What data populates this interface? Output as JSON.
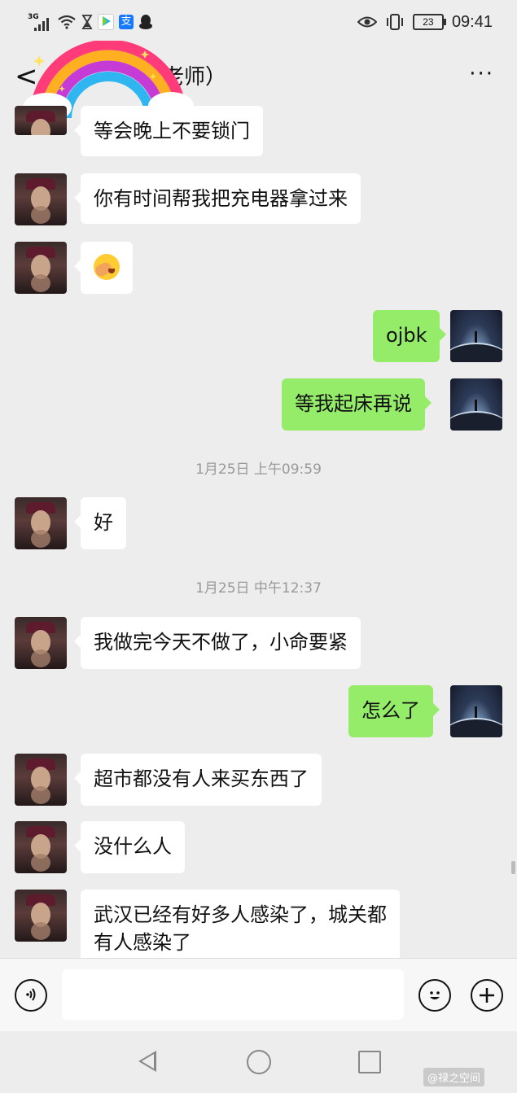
{
  "status_bar": {
    "network": "3G",
    "time": "09:41",
    "battery": "23",
    "app_icons": [
      "hourglass-icon",
      "video-app-icon",
      "alipay-icon",
      "qq-icon"
    ]
  },
  "header": {
    "back_label": "<",
    "title": "老师）",
    "more_label": "···"
  },
  "messages": [
    {
      "side": "in",
      "text": "等会晚上不要锁门"
    },
    {
      "side": "in",
      "text": "你有时间帮我把充电器拿过来"
    },
    {
      "side": "in",
      "text": "",
      "emoji": "facepalm-emoji"
    },
    {
      "side": "out",
      "text": "ojbk"
    },
    {
      "side": "out",
      "text": "等我起床再说"
    },
    {
      "type": "timestamp",
      "text": "1月25日 上午09:59"
    },
    {
      "side": "in",
      "text": "好"
    },
    {
      "type": "timestamp",
      "text": "1月25日 中午12:37"
    },
    {
      "side": "in",
      "text": "我做完今天不做了，小命要紧"
    },
    {
      "side": "out",
      "text": "怎么了"
    },
    {
      "side": "in",
      "text": "超市都没有人来买东西了"
    },
    {
      "side": "in",
      "text": "没什么人"
    },
    {
      "side": "in",
      "text_line1": "武汉已经有好多人感染了，城关都",
      "text_line2": "有人感染了"
    }
  ],
  "input_bar": {
    "value": "",
    "placeholder": ""
  },
  "watermark": "@禄之空间",
  "colors": {
    "background": "#ededed",
    "outgoing_bubble": "#95ec69",
    "incoming_bubble": "#ffffff",
    "timestamp": "#999999"
  }
}
